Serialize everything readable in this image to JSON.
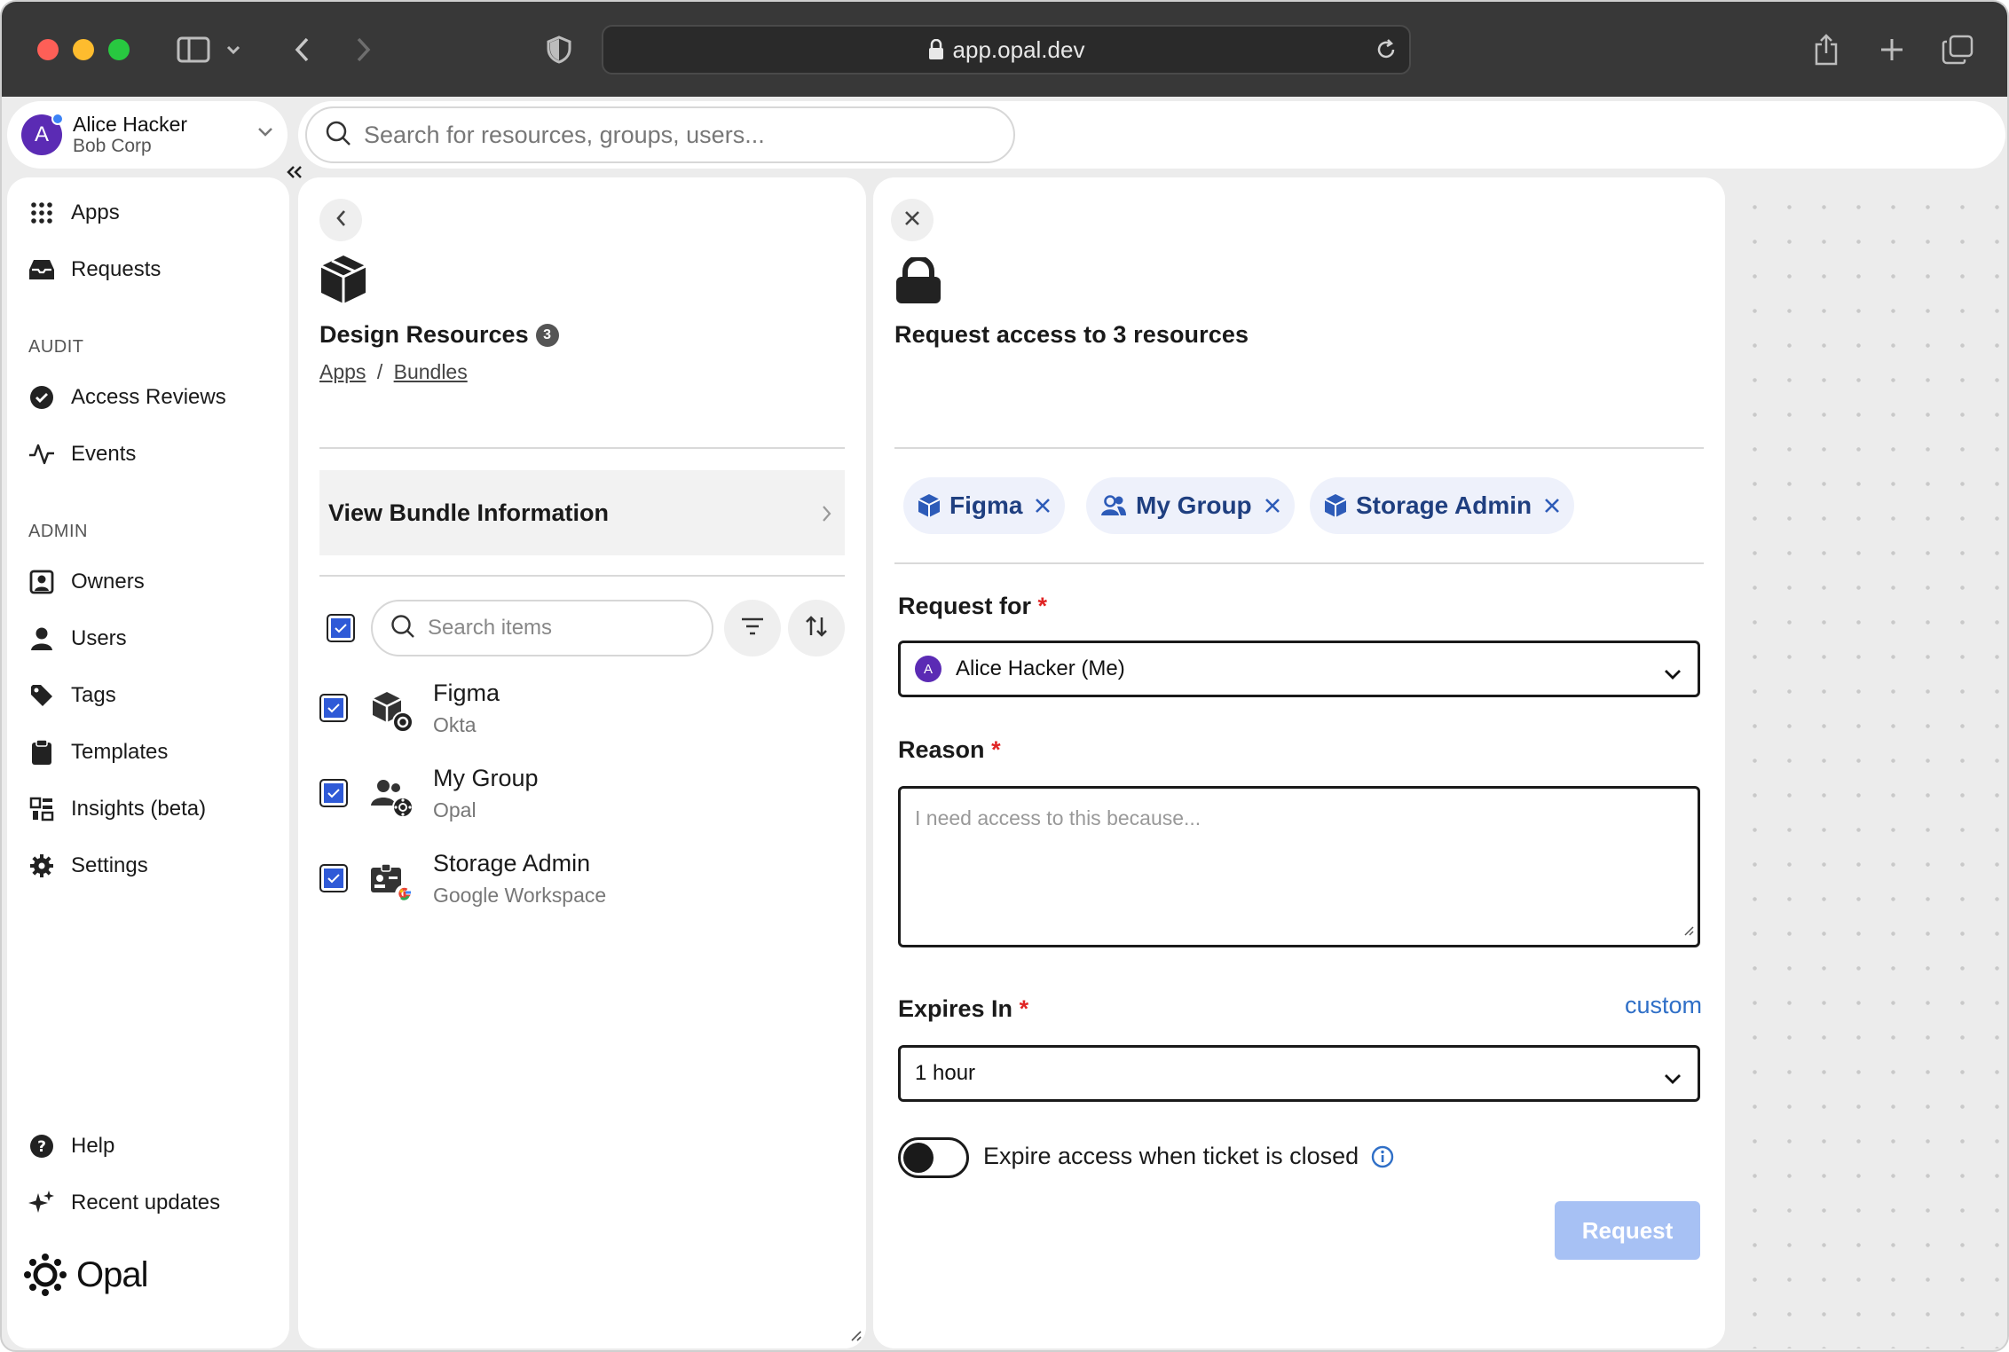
{
  "browser": {
    "url": "app.opal.dev",
    "icons": [
      "sidebar-icon",
      "chevron-down-icon",
      "back-icon",
      "forward-icon",
      "shield-icon",
      "lock-icon",
      "reload-icon",
      "share-icon",
      "new-tab-icon",
      "tabs-icon"
    ]
  },
  "account": {
    "name": "Alice Hacker",
    "org": "Bob Corp",
    "initial": "A"
  },
  "global_search": {
    "placeholder": "Search for resources, groups, users..."
  },
  "sidebar": {
    "top_items": [
      {
        "label": "Apps",
        "icon": "grid-icon"
      },
      {
        "label": "Requests",
        "icon": "inbox-icon"
      }
    ],
    "audit_label": "AUDIT",
    "audit_items": [
      {
        "label": "Access Reviews",
        "icon": "check-circle-icon"
      },
      {
        "label": "Events",
        "icon": "activity-icon"
      }
    ],
    "admin_label": "ADMIN",
    "admin_items": [
      {
        "label": "Owners",
        "icon": "owner-icon"
      },
      {
        "label": "Users",
        "icon": "user-icon"
      },
      {
        "label": "Tags",
        "icon": "tag-icon"
      },
      {
        "label": "Templates",
        "icon": "clipboard-icon"
      },
      {
        "label": "Insights (beta)",
        "icon": "insights-icon"
      },
      {
        "label": "Settings",
        "icon": "gear-icon"
      }
    ],
    "bottom_items": [
      {
        "label": "Help",
        "icon": "help-icon"
      },
      {
        "label": "Recent updates",
        "icon": "sparkle-icon"
      }
    ],
    "logo_text": "Opal"
  },
  "bundle": {
    "title": "Design Resources",
    "count": "3",
    "breadcrumbs": [
      "Apps",
      "Bundles"
    ],
    "breadcrumb_sep": "/",
    "view_info_label": "View Bundle Information",
    "search_placeholder": "Search items",
    "items": [
      {
        "name": "Figma",
        "source": "Okta",
        "icon": "resource-okta-icon",
        "checked": true
      },
      {
        "name": "My Group",
        "source": "Opal",
        "icon": "group-opal-icon",
        "checked": true
      },
      {
        "name": "Storage Admin",
        "source": "Google Workspace",
        "icon": "role-google-icon",
        "checked": true
      }
    ]
  },
  "request": {
    "title": "Request access to 3 resources",
    "chips": [
      {
        "label": "Figma",
        "icon": "cube-icon"
      },
      {
        "label": "My Group",
        "icon": "users-icon"
      },
      {
        "label": "Storage Admin",
        "icon": "cube-icon"
      }
    ],
    "request_for_label": "Request for",
    "request_for_value": "Alice Hacker (Me)",
    "request_for_initial": "A",
    "reason_label": "Reason",
    "reason_placeholder": "I need access to this because...",
    "expires_label": "Expires In",
    "custom_label": "custom",
    "expires_value": "1 hour",
    "toggle_label": "Expire access when ticket is closed",
    "toggle_on": false,
    "submit_label": "Request",
    "required_mark": "*",
    "colors": {
      "accent": "#2f6fc7",
      "disabled_button": "#a7c1f4",
      "chip_bg": "#eef1fb",
      "chip_text": "#1f3f80",
      "required": "#e02424"
    }
  }
}
